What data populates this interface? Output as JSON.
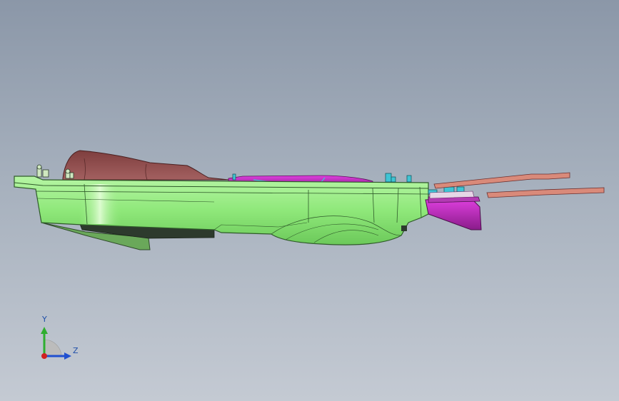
{
  "viewport": {
    "view": "side",
    "colors": {
      "background_top": "#8b97a8",
      "background_bottom": "#c4cad3",
      "housing": "#8fe87a",
      "housing_edge": "#2f5a2a",
      "cover": "#8a4a4a",
      "insert": "#cc33cc",
      "rails": "#d98a7a",
      "fittings": "#3fc4d4"
    }
  },
  "triad": {
    "y_label": "Y",
    "z_label": "Z",
    "y_color": "#2fae2f",
    "z_color": "#2050d0",
    "x_color": "#d02020"
  }
}
